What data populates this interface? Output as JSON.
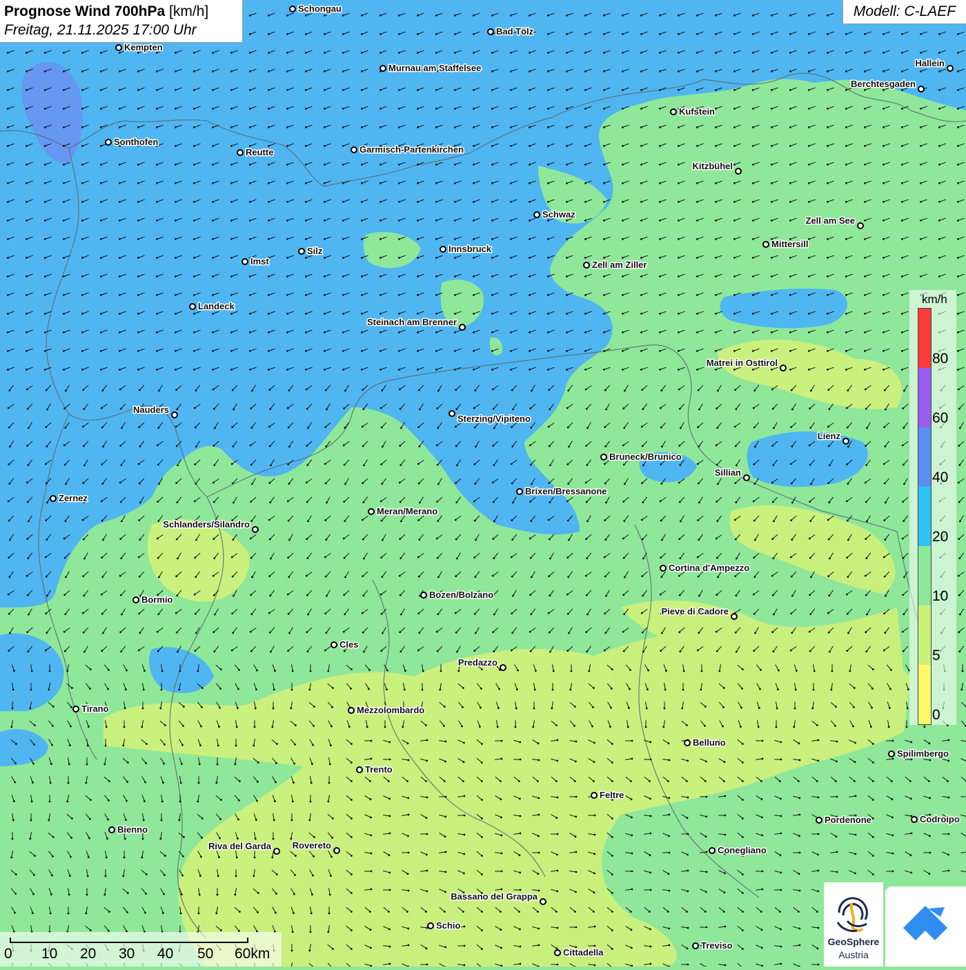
{
  "header": {
    "title_bold": "Prognose Wind 700hPa",
    "title_unit": "[km/h]",
    "datetime": "Freitag, 21.11.2025 17:00 Uhr",
    "model": "Modell: C-LAEF"
  },
  "legend": {
    "unit": "km/h",
    "ticks": [
      "80",
      "60",
      "40",
      "20",
      "10",
      "5",
      "0"
    ],
    "colors": [
      "#ff3b3b",
      "#9b5df0",
      "#5b8ef0",
      "#2ec2f5",
      "#8ee89a",
      "#c8f27a",
      "#fff86a"
    ]
  },
  "scale": {
    "labels": [
      "0",
      "10",
      "20",
      "30",
      "40",
      "50",
      "60km"
    ]
  },
  "logos": {
    "geosphere_name": "GeoSphere",
    "geosphere_sub": "Austria"
  },
  "colors": {
    "strong_wind": "#4fb6f2",
    "moderate_wind": "#8fe79a",
    "light_wind": "#cdf07c",
    "very_strong": "#6d8cf0"
  },
  "cities": [
    {
      "name": "Schongau"
    },
    {
      "name": "Bad Tölz"
    },
    {
      "name": "Kempten"
    },
    {
      "name": "Hallein"
    },
    {
      "name": "Murnau am Staffelsee"
    },
    {
      "name": "Berchtesgaden"
    },
    {
      "name": "Kufstein"
    },
    {
      "name": "Sonthofen"
    },
    {
      "name": "Reutte"
    },
    {
      "name": "Garmisch-Partenkirchen"
    },
    {
      "name": "Kitzbühel"
    },
    {
      "name": "Schwaz"
    },
    {
      "name": "Zell am See"
    },
    {
      "name": "Innsbruck"
    },
    {
      "name": "Silz"
    },
    {
      "name": "Mittersill"
    },
    {
      "name": "Imst"
    },
    {
      "name": "Zell am Ziller"
    },
    {
      "name": "Landeck"
    },
    {
      "name": "Steinach am Brenner"
    },
    {
      "name": "Matrei in Osttirol"
    },
    {
      "name": "Nauders"
    },
    {
      "name": "Sterzing/Vipiteno"
    },
    {
      "name": "Lienz"
    },
    {
      "name": "Bruneck/Brunico"
    },
    {
      "name": "Sillian"
    },
    {
      "name": "Brixen/Bressanone"
    },
    {
      "name": "Zernez"
    },
    {
      "name": "Meran/Merano"
    },
    {
      "name": "Schlanders/Silandro"
    },
    {
      "name": "Cortina d'Ampezzo"
    },
    {
      "name": "Bozen/Bolzano"
    },
    {
      "name": "Bormio"
    },
    {
      "name": "Pieve di Cadore"
    },
    {
      "name": "Cles"
    },
    {
      "name": "Predazzo"
    },
    {
      "name": "Tirano"
    },
    {
      "name": "Mezzolombardo"
    },
    {
      "name": "Belluno"
    },
    {
      "name": "Spilimbergo"
    },
    {
      "name": "Trento"
    },
    {
      "name": "Feltre"
    },
    {
      "name": "Pordenone"
    },
    {
      "name": "Codroipo"
    },
    {
      "name": "Bienno"
    },
    {
      "name": "Riva del Garda"
    },
    {
      "name": "Rovereto"
    },
    {
      "name": "Conegliano"
    },
    {
      "name": "Bassano del Grappa"
    },
    {
      "name": "Schio"
    },
    {
      "name": "Treviso"
    },
    {
      "name": "Cittadella"
    }
  ]
}
